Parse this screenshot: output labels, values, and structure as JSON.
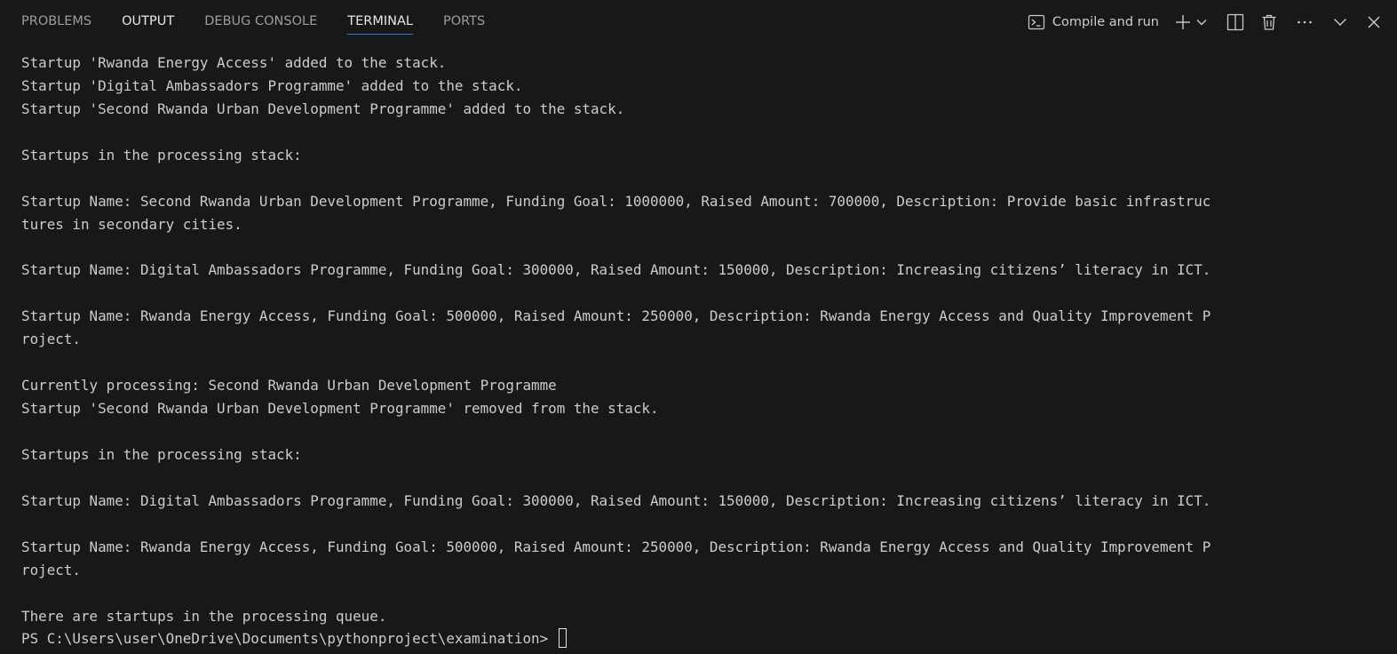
{
  "tabs": [
    {
      "label": "PROBLEMS",
      "active": false
    },
    {
      "label": "OUTPUT",
      "active": false
    },
    {
      "label": "DEBUG CONSOLE",
      "active": false
    },
    {
      "label": "TERMINAL",
      "active": true
    },
    {
      "label": "PORTS",
      "active": false
    }
  ],
  "toolbar": {
    "task_label": "Compile and run",
    "icons": [
      "terminal-icon",
      "plus-icon",
      "chevron-down-icon",
      "split-icon",
      "trash-icon",
      "ellipsis-icon",
      "chevron-down-icon",
      "close-icon"
    ]
  },
  "colors": {
    "background": "#181818",
    "text": "#cccccc",
    "active_tab_underline": "#2f80d0"
  },
  "terminal": {
    "lines": [
      "Startup 'Rwanda Energy Access' added to the stack.",
      "Startup 'Digital Ambassadors Programme' added to the stack.",
      "Startup 'Second Rwanda Urban Development Programme' added to the stack.",
      "",
      "Startups in the processing stack:",
      "",
      "Startup Name: Second Rwanda Urban Development Programme, Funding Goal: 1000000, Raised Amount: 700000, Description: Provide basic infrastruc",
      "tures in secondary cities.",
      "",
      "Startup Name: Digital Ambassadors Programme, Funding Goal: 300000, Raised Amount: 150000, Description: Increasing citizens’ literacy in ICT.",
      "",
      "Startup Name: Rwanda Energy Access, Funding Goal: 500000, Raised Amount: 250000, Description: Rwanda Energy Access and Quality Improvement P",
      "roject.",
      "",
      "Currently processing: Second Rwanda Urban Development Programme",
      "Startup 'Second Rwanda Urban Development Programme' removed from the stack.",
      "",
      "Startups in the processing stack:",
      "",
      "Startup Name: Digital Ambassadors Programme, Funding Goal: 300000, Raised Amount: 150000, Description: Increasing citizens’ literacy in ICT.",
      "",
      "Startup Name: Rwanda Energy Access, Funding Goal: 500000, Raised Amount: 250000, Description: Rwanda Energy Access and Quality Improvement P",
      "roject.",
      "",
      "There are startups in the processing queue."
    ],
    "prompt": "PS C:\\Users\\user\\OneDrive\\Documents\\pythonproject\\examination> "
  }
}
